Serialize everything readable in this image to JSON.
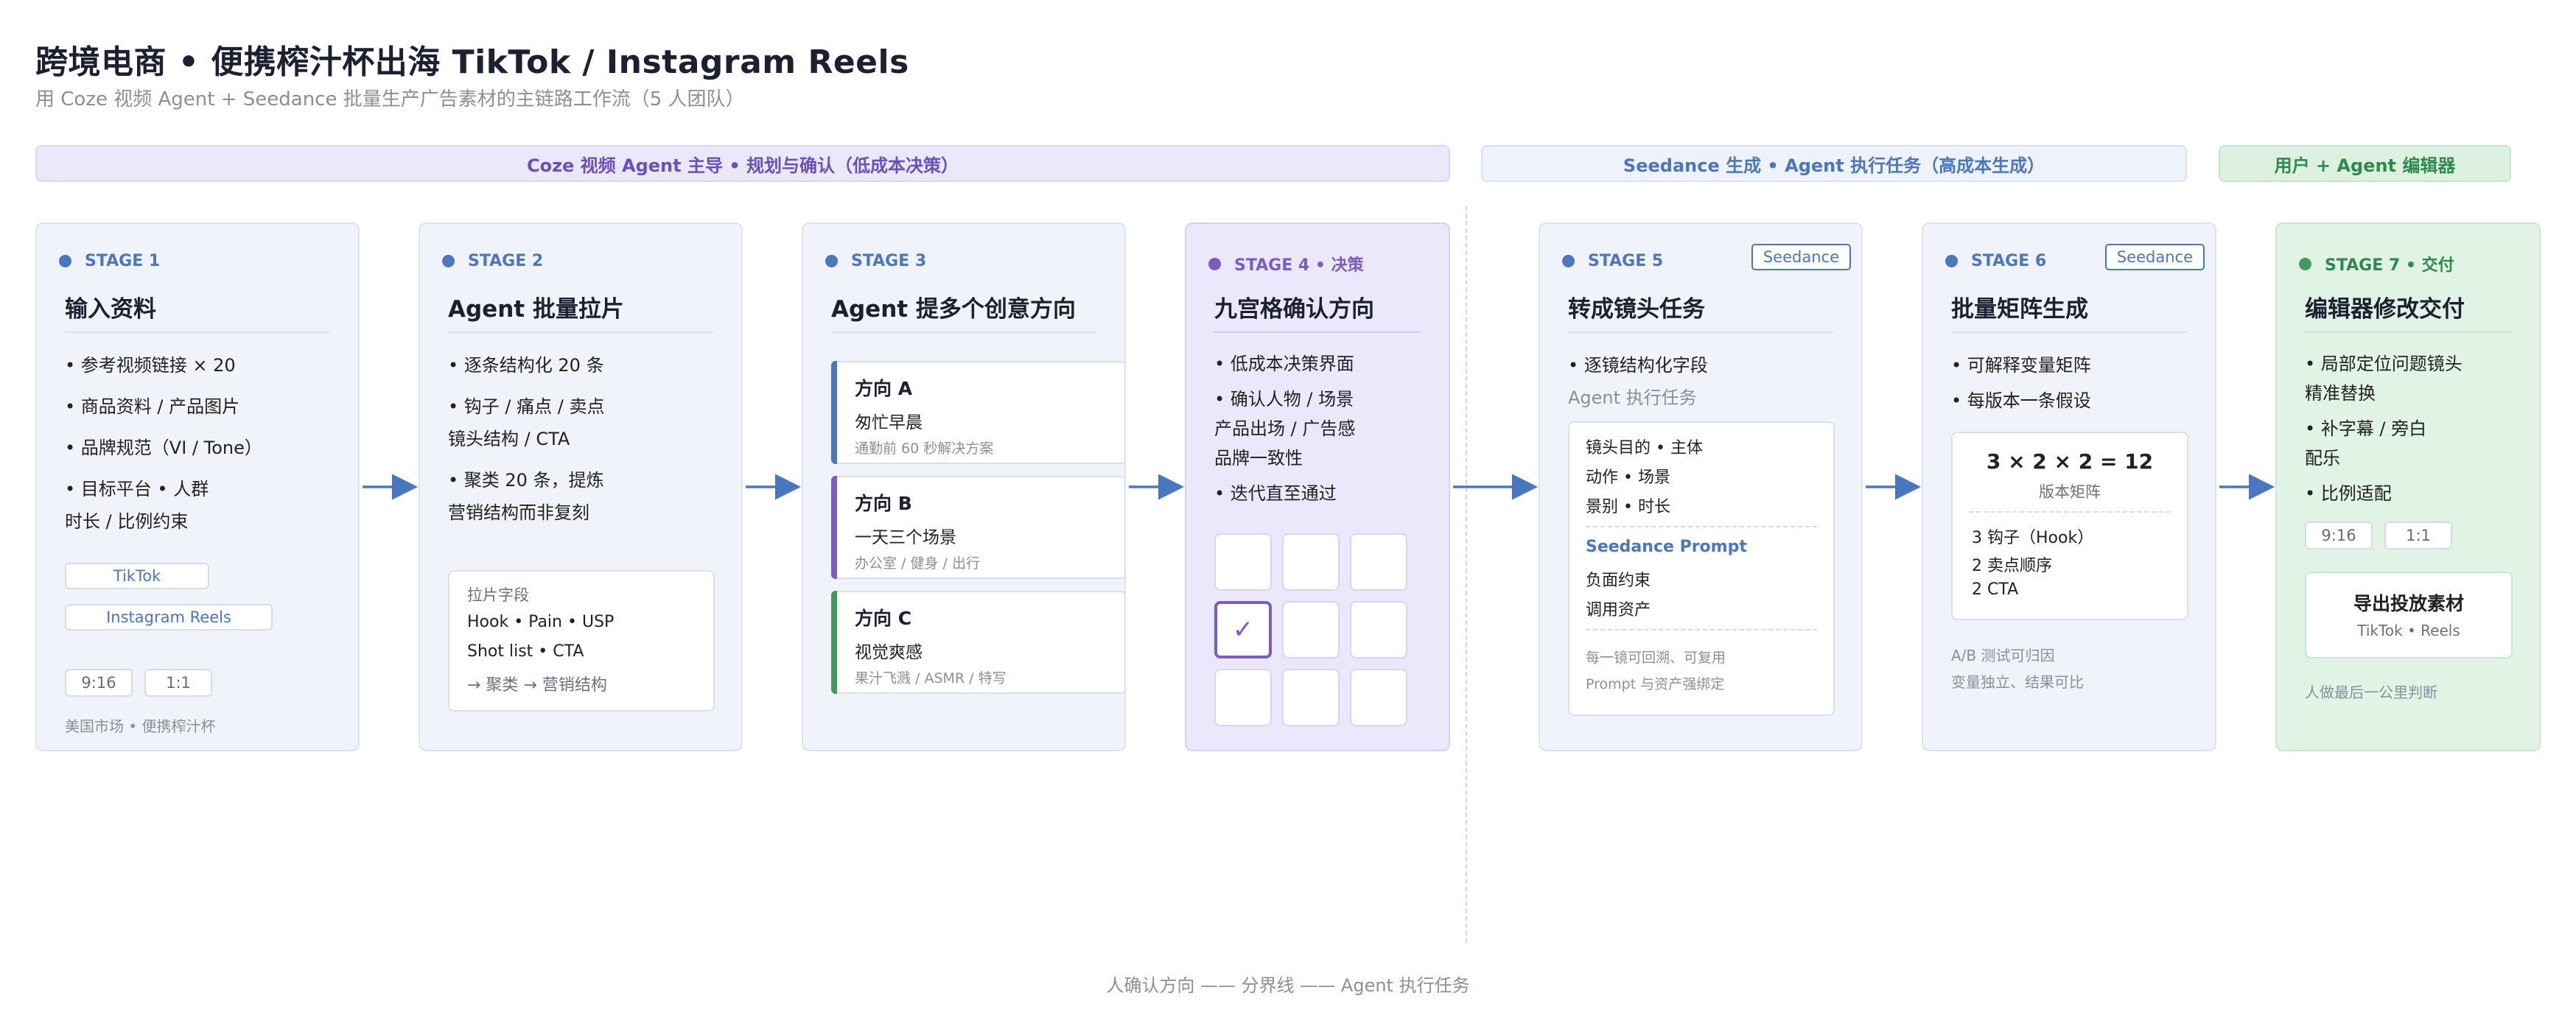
{
  "header": {
    "title": "跨境电商 • 便携榨汁杯出海 TikTok / Instagram Reels",
    "subtitle": "用 Coze 视频 Agent + Seedance 批量生产广告素材的主链路工作流（5 人团队）"
  },
  "bands": {
    "coze": "Coze 视频 Agent 主导 • 规划与确认（低成本决策）",
    "seedance": "Seedance 生成 • Agent 执行任务（高成本生成）",
    "user": "用户 + Agent 编辑器"
  },
  "stage1": {
    "label": "STAGE 1",
    "title": "输入资料",
    "bullets": [
      "• 参考视频链接 × 20",
      "• 商品资料 / 产品图片",
      "• 品牌规范（VI / Tone）",
      "• 目标平台 • 人群",
      "时长 / 比例约束"
    ],
    "platforms": [
      "TikTok",
      "Instagram Reels"
    ],
    "ratios": [
      "9:16",
      "1:1"
    ],
    "note": "美国市场 • 便携榨汁杯"
  },
  "stage2": {
    "label": "STAGE 2",
    "title": "Agent 批量拉片",
    "bullets": [
      "• 逐条结构化 20 条",
      "• 钩子 / 痛点 / 卖点",
      "镜头结构 / CTA",
      "• 聚类 20 条，提炼",
      "营销结构而非复刻"
    ],
    "box": {
      "heading": "拉片字段",
      "line1": "Hook • Pain • USP",
      "line2": "Shot list • CTA",
      "line3": "→ 聚类 → 营销结构"
    }
  },
  "stage3": {
    "label": "STAGE 3",
    "title": "Agent 提多个创意方向",
    "directions": [
      {
        "title": "方向 A",
        "desc": "匆忙早晨",
        "sub": "通勤前 60 秒解决方案"
      },
      {
        "title": "方向 B",
        "desc": "一天三个场景",
        "sub": "办公室 / 健身 / 出行"
      },
      {
        "title": "方向 C",
        "desc": "视觉爽感",
        "sub": "果汁飞溅 / ASMR / 特写"
      }
    ],
    "colors": {
      "a": "#4a76c2",
      "b": "#7a5cc8",
      "c": "#3f9a5c"
    }
  },
  "stage4": {
    "label": "STAGE 4 • 决策",
    "title": "九宫格确认方向",
    "bullets": [
      "• 低成本决策界面",
      "• 确认人物 / 场景",
      "产品出场 / 广告感",
      "品牌一致性",
      "• 迭代直至通过"
    ],
    "check": "✓"
  },
  "stage5": {
    "label": "STAGE 5",
    "badge": "Seedance",
    "title": "转成镜头任务",
    "bullets": [
      "• 逐镜结构化字段"
    ],
    "sub": "Agent 执行任务",
    "box": {
      "l1": "镜头目的 • 主体",
      "l2": "动作 • 场景",
      "l3": "景别 • 时长",
      "prompt": "Seedance Prompt",
      "l4": "负面约束",
      "l5": "调用资产",
      "n1": "每一镜可回溯、可复用",
      "n2": "Prompt 与资产强绑定"
    }
  },
  "stage6": {
    "label": "STAGE 6",
    "badge": "Seedance",
    "title": "批量矩阵生成",
    "bullets": [
      "• 可解释变量矩阵",
      "• 每版本一条假设"
    ],
    "box": {
      "formula": "3 × 2 × 2 = 12",
      "formula_label": "版本矩阵",
      "l1": "3 钩子（Hook）",
      "l2": "2 卖点顺序",
      "l3": "2 CTA"
    },
    "note1": "A/B 测试可归因",
    "note2": "变量独立、结果可比"
  },
  "stage7": {
    "label": "STAGE 7 • 交付",
    "title": "编辑器修改交付",
    "bullets": [
      "• 局部定位问题镜头",
      "精准替换",
      "• 补字幕 / 旁白",
      "配乐",
      "• 比例适配"
    ],
    "ratios": [
      "9:16",
      "1:1"
    ],
    "export": {
      "title": "导出投放素材",
      "sub": "TikTok • Reels"
    },
    "note": "人做最后一公里判断"
  },
  "footer": "人确认方向 —— 分界线 —— Agent 执行任务"
}
